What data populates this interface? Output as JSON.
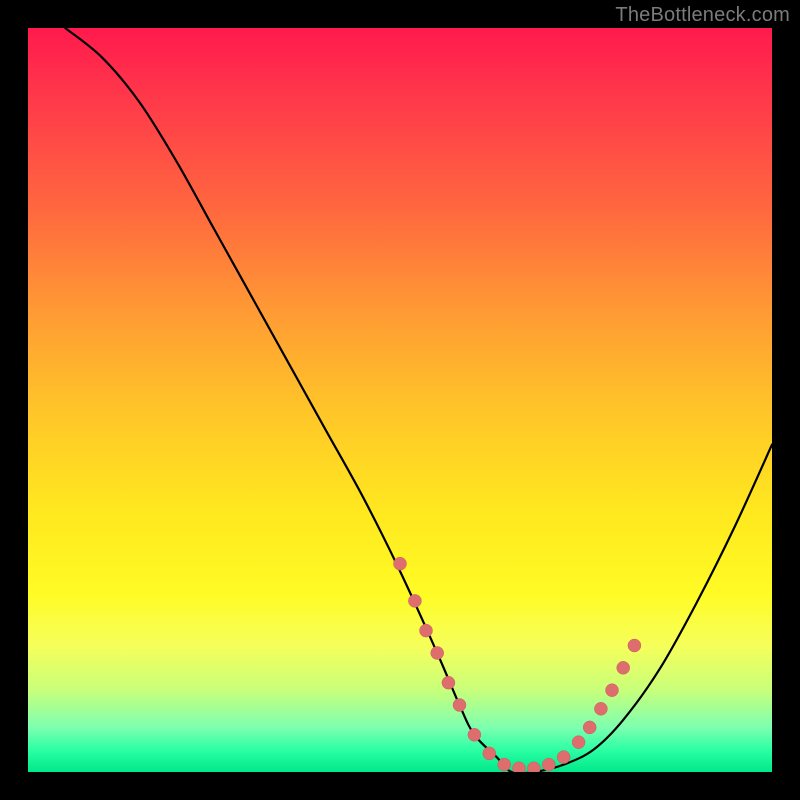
{
  "watermark": "TheBottleneck.com",
  "colors": {
    "background": "#000000",
    "curve": "#000000",
    "dot_fill": "#de6e6e",
    "dot_stroke": "#c95d5d"
  },
  "chart_data": {
    "type": "line",
    "title": "",
    "xlabel": "",
    "ylabel": "",
    "xlim": [
      0,
      100
    ],
    "ylim": [
      0,
      100
    ],
    "grid": false,
    "legend": false,
    "note": "Axes unlabeled; values estimated from curve geometry. Y axis inverted visually (higher y = lower on screen).",
    "series": [
      {
        "name": "bottleneck-curve",
        "x": [
          5,
          10,
          15,
          20,
          25,
          30,
          35,
          40,
          45,
          50,
          55,
          58,
          60,
          63,
          65,
          68,
          72,
          76,
          80,
          85,
          90,
          95,
          100
        ],
        "y": [
          100,
          96,
          90,
          82,
          73,
          64,
          55,
          46,
          37,
          27,
          16,
          9,
          5,
          2,
          0,
          0,
          1,
          3,
          7,
          14,
          23,
          33,
          44
        ]
      }
    ],
    "highlight_points": {
      "name": "marker-dots",
      "x": [
        50,
        52,
        53.5,
        55,
        56.5,
        58,
        60,
        62,
        64,
        66,
        68,
        70,
        72,
        74,
        75.5,
        77,
        78.5,
        80,
        81.5
      ],
      "y": [
        28,
        23,
        19,
        16,
        12,
        9,
        5,
        2.5,
        1,
        0.5,
        0.5,
        1,
        2,
        4,
        6,
        8.5,
        11,
        14,
        17
      ]
    }
  }
}
